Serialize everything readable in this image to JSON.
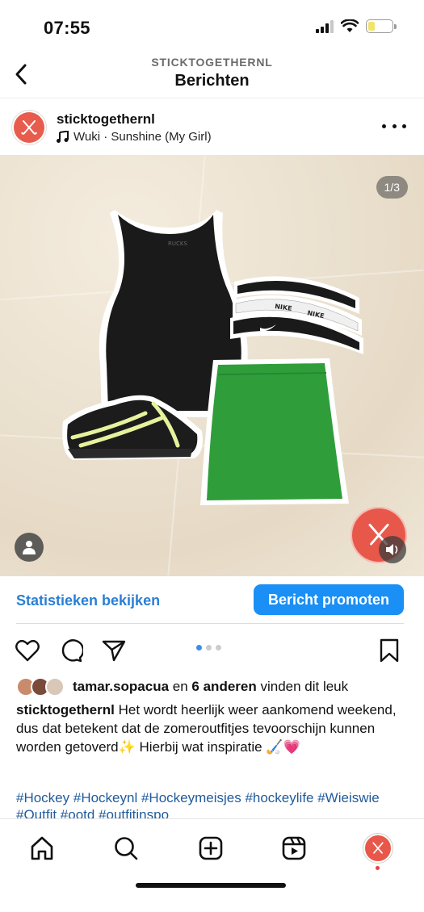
{
  "status_bar": {
    "time": "07:55"
  },
  "header": {
    "subtitle": "STICKTOGETHERNL",
    "title": "Berichten"
  },
  "post": {
    "username": "sticktogethernl",
    "song": "Wuki · Sunshine (My Girl)",
    "slide_counter": "1/3",
    "insights_label": "Statistieken bekijken",
    "promote_label": "Bericht promoten",
    "likes": {
      "liker": "tamar.sopacua",
      "connector": " en ",
      "others": "6 anderen",
      "suffix": " vinden dit leuk"
    },
    "caption_user": "sticktogethernl",
    "caption_text": " Het wordt heerlijk weer aankomend weekend, dus dat betekent dat de zomeroutfitjes tevoorschijn kunnen worden getoverd✨ Hierbij wat inspiratie 🏑💗",
    "hashtags": "#Hockey #Hockeynl #Hockeymeisjes #hockeylife #Wieiswie #Outfit #ootd #outfitinspo",
    "carousel": {
      "count": 3,
      "active": 1
    }
  },
  "colors": {
    "accent_blue": "#1a8ff5",
    "link_blue": "#2a7fd4",
    "brand_red": "#e8584a",
    "skirt_green": "#2f9e3a"
  },
  "icons": {
    "back": "chevron-left-icon",
    "more": "more-horizontal-icon",
    "like": "heart-icon",
    "comment": "comment-icon",
    "share": "send-icon",
    "save": "bookmark-icon",
    "home": "home-icon",
    "search": "search-icon",
    "create": "plus-square-icon",
    "reels": "reels-icon"
  }
}
